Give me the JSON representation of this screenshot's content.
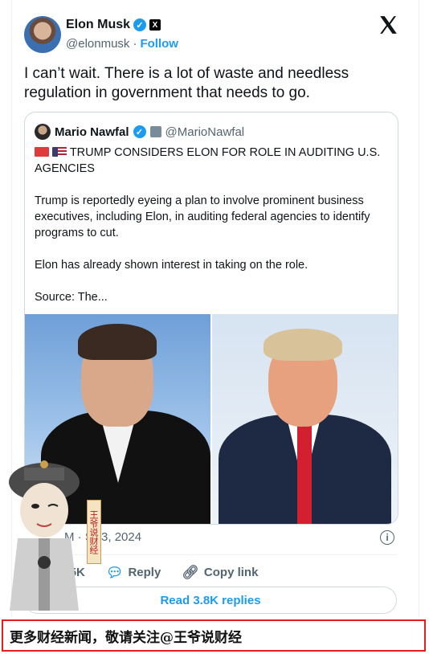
{
  "author": {
    "name": "Elon Musk",
    "handle": "@elonmusk",
    "separator": "·",
    "follow_label": "Follow"
  },
  "tweet_text": "I can’t wait. There is a lot of waste and needless regulation in government that needs to go.",
  "quoted": {
    "name": "Mario Nawfal",
    "handle": "@MarioNawfal",
    "headline": "TRUMP CONSIDERS ELON FOR ROLE IN AUDITING U.S. AGENCIES",
    "paragraph1": "Trump is reportedly eyeing a plan to involve prominent business executives, including Elon, in auditing federal agencies to identify programs to cut.",
    "paragraph2": "Elon has already shown interest in taking on the role.",
    "source": "Source: The..."
  },
  "meta": {
    "timestamp_visible": "M · S",
    "date_visible": "3, 2024"
  },
  "actions": {
    "likes_visible": "5K",
    "reply_label": "Reply",
    "copy_link_label": "Copy link"
  },
  "read_replies_label": "Read 3.8K replies",
  "banner_text": "更多财经新闻，敬请关注@王爷说财经",
  "seal_text": "王爷说财经",
  "icons": {
    "x_logo": "x-logo-icon",
    "verified": "verified-badge-icon",
    "info": "info-icon",
    "heart": "heart-icon",
    "reply": "reply-icon",
    "link": "link-icon"
  },
  "colors": {
    "accent": "#1d9bf0",
    "text": "#0f1419",
    "muted": "#536471",
    "banner_border": "#e02020"
  }
}
